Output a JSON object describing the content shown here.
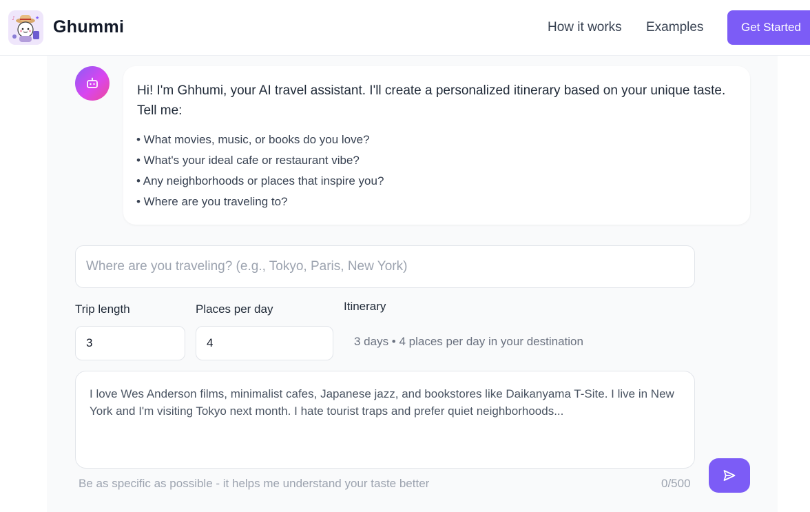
{
  "header": {
    "brand": "Ghummi",
    "nav": [
      {
        "label": "How it works"
      },
      {
        "label": "Examples"
      }
    ],
    "cta_label": "Get Started"
  },
  "chat": {
    "greeting": "Hi! I'm Ghhumi, your AI travel assistant. I'll create a personalized itinerary based on your unique taste. Tell me:",
    "bullets": [
      "• What movies, music, or books do you love?",
      "• What's your ideal cafe or restaurant vibe?",
      "• Any neighborhoods or places that inspire you?",
      "• Where are you traveling to?"
    ]
  },
  "form": {
    "destination_placeholder": "Where are you traveling? (e.g., Tokyo, Paris, New York)",
    "trip_length_label": "Trip length",
    "trip_length_value": "3",
    "places_label": "Places per day",
    "places_value": "4",
    "itinerary_label": "Itinerary",
    "itinerary_summary": "3 days • 4 places per day in your destination",
    "preferences_text": "I love Wes Anderson films, minimalist cafes, Japanese jazz, and bookstores like Daikanyama T-Site. I live in New York and I'm visiting Tokyo next month. I hate tourist traps and prefer quiet neighborhoods...",
    "hint": "Be as specific as possible - it helps me understand your taste better",
    "char_count": "0/500"
  },
  "icons": {
    "logo": "mascot-logo-icon",
    "bot": "robot-icon",
    "send": "send-icon"
  },
  "colors": {
    "accent": "#7c5cf6",
    "panel_bg": "#f9fafb",
    "avatar_gradient_start": "#8b5cf6",
    "avatar_gradient_end": "#ec4899"
  }
}
